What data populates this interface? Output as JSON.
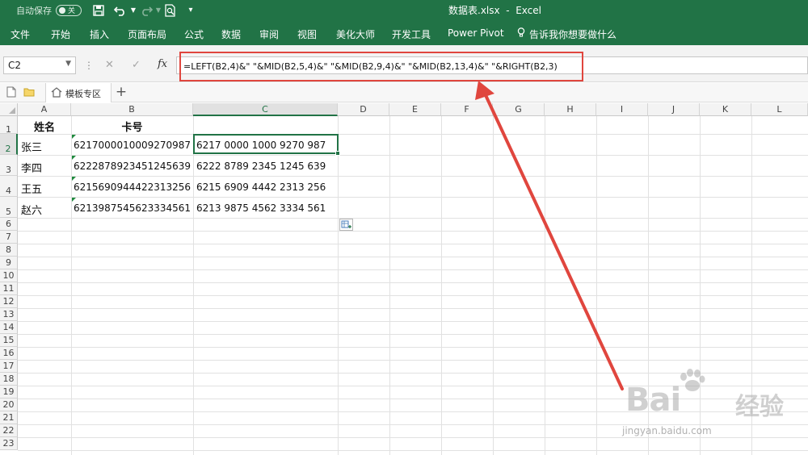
{
  "title_bar": {
    "autosave_label": "自动保存",
    "autosave_state": "关",
    "document_title": "数据表.xlsx  -  Excel",
    "bg_color": "#217346"
  },
  "ribbon": {
    "tabs": [
      "文件",
      "开始",
      "插入",
      "页面布局",
      "公式",
      "数据",
      "审阅",
      "视图",
      "美化大师",
      "开发工具",
      "Power Pivot"
    ],
    "tell_me": "告诉我你想要做什么"
  },
  "formula_bar": {
    "name_box": "C2",
    "formula": "=LEFT(B2,4)&\" \"&MID(B2,5,4)&\" \"&MID(B2,9,4)&\" \"&MID(B2,13,4)&\" \"&RIGHT(B2,3)"
  },
  "tab_strip": {
    "template_tab": "模板专区",
    "add_label": "+"
  },
  "sheet": {
    "columns": [
      "A",
      "B",
      "C",
      "D",
      "E",
      "F",
      "G",
      "H",
      "I",
      "J",
      "K",
      "L"
    ],
    "rows": [
      "1",
      "2",
      "3",
      "4",
      "5",
      "6",
      "7",
      "8",
      "9",
      "10",
      "11",
      "12",
      "13",
      "14",
      "15",
      "16",
      "17",
      "18",
      "19",
      "20",
      "21",
      "22",
      "23"
    ],
    "active_cell": "C2",
    "headers": {
      "name": "姓名",
      "card": "卡号"
    },
    "data": [
      {
        "name": "张三",
        "card": "6217000010009270987",
        "formatted": "6217 0000 1000 9270 987"
      },
      {
        "name": "李四",
        "card": "6222878923451245639",
        "formatted": "6222 8789 2345 1245 639"
      },
      {
        "name": "王五",
        "card": "6215690944422313256",
        "formatted": "6215 6909 4442 2313 256"
      },
      {
        "name": "赵六",
        "card": "6213987545623334561",
        "formatted": "6213 9875 4562 3334 561"
      }
    ]
  },
  "annotation": {
    "color": "#e0463e"
  },
  "watermark": {
    "brand": "Bai",
    "brand_suffix": "经验",
    "url": "jingyan.baidu.com"
  }
}
